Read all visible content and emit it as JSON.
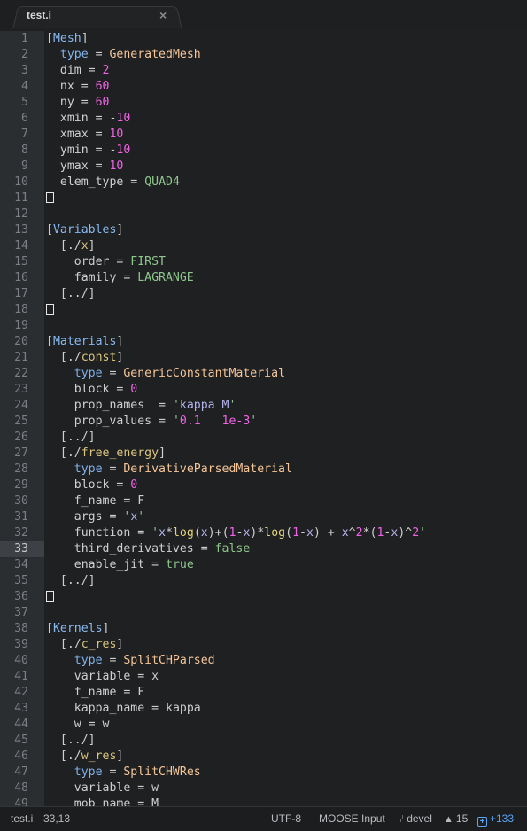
{
  "tab": {
    "title": "test.i",
    "close_symbol": "×"
  },
  "editor": {
    "current_line": 33,
    "lines": [
      [
        [
          "sec",
          "["
        ],
        [
          "secname",
          "Mesh"
        ],
        [
          "sec",
          "]"
        ]
      ],
      [
        [
          "ind",
          "  "
        ],
        [
          "type",
          "type"
        ],
        [
          "op",
          " = "
        ],
        [
          "cls",
          "GeneratedMesh"
        ]
      ],
      [
        [
          "ind",
          "  "
        ],
        [
          "txt",
          "dim"
        ],
        [
          "op",
          " = "
        ],
        [
          "num",
          "2"
        ]
      ],
      [
        [
          "ind",
          "  "
        ],
        [
          "txt",
          "nx"
        ],
        [
          "op",
          " = "
        ],
        [
          "num",
          "60"
        ]
      ],
      [
        [
          "ind",
          "  "
        ],
        [
          "txt",
          "ny"
        ],
        [
          "op",
          " = "
        ],
        [
          "num",
          "60"
        ]
      ],
      [
        [
          "ind",
          "  "
        ],
        [
          "txt",
          "xmin"
        ],
        [
          "op",
          " = -"
        ],
        [
          "num",
          "10"
        ]
      ],
      [
        [
          "ind",
          "  "
        ],
        [
          "txt",
          "xmax"
        ],
        [
          "op",
          " = "
        ],
        [
          "num",
          "10"
        ]
      ],
      [
        [
          "ind",
          "  "
        ],
        [
          "txt",
          "ymin"
        ],
        [
          "op",
          " = -"
        ],
        [
          "num",
          "10"
        ]
      ],
      [
        [
          "ind",
          "  "
        ],
        [
          "txt",
          "ymax"
        ],
        [
          "op",
          " = "
        ],
        [
          "num",
          "10"
        ]
      ],
      [
        [
          "ind",
          "  "
        ],
        [
          "txt",
          "elem_type"
        ],
        [
          "op",
          " = "
        ],
        [
          "const",
          "QUAD4"
        ]
      ],
      [
        [
          "box",
          ""
        ]
      ],
      [],
      [
        [
          "sec",
          "["
        ],
        [
          "secname",
          "Variables"
        ],
        [
          "sec",
          "]"
        ]
      ],
      [
        [
          "ind",
          "  "
        ],
        [
          "sec",
          "[./"
        ],
        [
          "sub",
          "x"
        ],
        [
          "sec",
          "]"
        ]
      ],
      [
        [
          "ind",
          "    "
        ],
        [
          "txt",
          "order"
        ],
        [
          "op",
          " = "
        ],
        [
          "const",
          "FIRST"
        ]
      ],
      [
        [
          "ind",
          "    "
        ],
        [
          "txt",
          "family"
        ],
        [
          "op",
          " = "
        ],
        [
          "const",
          "LAGRANGE"
        ]
      ],
      [
        [
          "ind",
          "  "
        ],
        [
          "sec",
          "[../]"
        ]
      ],
      [
        [
          "box",
          ""
        ]
      ],
      [],
      [
        [
          "sec",
          "["
        ],
        [
          "secname",
          "Materials"
        ],
        [
          "sec",
          "]"
        ]
      ],
      [
        [
          "ind",
          "  "
        ],
        [
          "sec",
          "[./"
        ],
        [
          "sub",
          "const"
        ],
        [
          "sec",
          "]"
        ]
      ],
      [
        [
          "ind",
          "    "
        ],
        [
          "type",
          "type"
        ],
        [
          "op",
          " = "
        ],
        [
          "cls",
          "GenericConstantMaterial"
        ]
      ],
      [
        [
          "ind",
          "    "
        ],
        [
          "txt",
          "block"
        ],
        [
          "op",
          " = "
        ],
        [
          "num",
          "0"
        ]
      ],
      [
        [
          "ind",
          "    "
        ],
        [
          "txt",
          "prop_names"
        ],
        [
          "op",
          "  = "
        ],
        [
          "q",
          "'"
        ],
        [
          "str",
          "kappa M"
        ],
        [
          "q",
          "'"
        ]
      ],
      [
        [
          "ind",
          "    "
        ],
        [
          "txt",
          "prop_values"
        ],
        [
          "op",
          " = "
        ],
        [
          "q",
          "'"
        ],
        [
          "num",
          "0.1   1e-3"
        ],
        [
          "q",
          "'"
        ]
      ],
      [
        [
          "ind",
          "  "
        ],
        [
          "sec",
          "[../]"
        ]
      ],
      [
        [
          "ind",
          "  "
        ],
        [
          "sec",
          "[./"
        ],
        [
          "sub",
          "free_energy"
        ],
        [
          "sec",
          "]"
        ]
      ],
      [
        [
          "ind",
          "    "
        ],
        [
          "type",
          "type"
        ],
        [
          "op",
          " = "
        ],
        [
          "cls",
          "DerivativeParsedMaterial"
        ]
      ],
      [
        [
          "ind",
          "    "
        ],
        [
          "txt",
          "block"
        ],
        [
          "op",
          " = "
        ],
        [
          "num",
          "0"
        ]
      ],
      [
        [
          "ind",
          "    "
        ],
        [
          "txt",
          "f_name"
        ],
        [
          "op",
          " = "
        ],
        [
          "txt",
          "F"
        ]
      ],
      [
        [
          "ind",
          "    "
        ],
        [
          "txt",
          "args"
        ],
        [
          "op",
          " = "
        ],
        [
          "q",
          "'"
        ],
        [
          "str",
          "x"
        ],
        [
          "q",
          "'"
        ]
      ],
      [
        [
          "ind",
          "    "
        ],
        [
          "txt",
          "function"
        ],
        [
          "op",
          " = "
        ],
        [
          "q",
          "'"
        ],
        [
          "str",
          "x"
        ],
        [
          "op",
          "*"
        ],
        [
          "fn",
          "log"
        ],
        [
          "op",
          "("
        ],
        [
          "str",
          "x"
        ],
        [
          "op",
          ")+("
        ],
        [
          "num",
          "1"
        ],
        [
          "op",
          "-"
        ],
        [
          "str",
          "x"
        ],
        [
          "op",
          ")*"
        ],
        [
          "fn",
          "log"
        ],
        [
          "op",
          "("
        ],
        [
          "num",
          "1"
        ],
        [
          "op",
          "-"
        ],
        [
          "str",
          "x"
        ],
        [
          "op",
          ") + "
        ],
        [
          "str",
          "x"
        ],
        [
          "op",
          "^"
        ],
        [
          "num",
          "2"
        ],
        [
          "op",
          "*("
        ],
        [
          "num",
          "1"
        ],
        [
          "op",
          "-"
        ],
        [
          "str",
          "x"
        ],
        [
          "op",
          ")^"
        ],
        [
          "num",
          "2"
        ],
        [
          "q",
          "'"
        ]
      ],
      [
        [
          "ind",
          "    "
        ],
        [
          "txt",
          "third_derivatives"
        ],
        [
          "op",
          " = "
        ],
        [
          "const",
          "false"
        ]
      ],
      [
        [
          "ind",
          "    "
        ],
        [
          "txt",
          "enable_jit"
        ],
        [
          "op",
          " = "
        ],
        [
          "const",
          "true"
        ]
      ],
      [
        [
          "ind",
          "  "
        ],
        [
          "sec",
          "[../]"
        ]
      ],
      [
        [
          "box",
          ""
        ]
      ],
      [],
      [
        [
          "sec",
          "["
        ],
        [
          "secname",
          "Kernels"
        ],
        [
          "sec",
          "]"
        ]
      ],
      [
        [
          "ind",
          "  "
        ],
        [
          "sec",
          "[./"
        ],
        [
          "sub",
          "c_res"
        ],
        [
          "sec",
          "]"
        ]
      ],
      [
        [
          "ind",
          "    "
        ],
        [
          "type",
          "type"
        ],
        [
          "op",
          " = "
        ],
        [
          "cls",
          "SplitCHParsed"
        ]
      ],
      [
        [
          "ind",
          "    "
        ],
        [
          "txt",
          "variable"
        ],
        [
          "op",
          " = "
        ],
        [
          "txt",
          "x"
        ]
      ],
      [
        [
          "ind",
          "    "
        ],
        [
          "txt",
          "f_name"
        ],
        [
          "op",
          " = "
        ],
        [
          "txt",
          "F"
        ]
      ],
      [
        [
          "ind",
          "    "
        ],
        [
          "txt",
          "kappa_name"
        ],
        [
          "op",
          " = "
        ],
        [
          "txt",
          "kappa"
        ]
      ],
      [
        [
          "ind",
          "    "
        ],
        [
          "txt",
          "w"
        ],
        [
          "op",
          " = "
        ],
        [
          "txt",
          "w"
        ]
      ],
      [
        [
          "ind",
          "  "
        ],
        [
          "sec",
          "[../]"
        ]
      ],
      [
        [
          "ind",
          "  "
        ],
        [
          "sec",
          "[./"
        ],
        [
          "sub",
          "w_res"
        ],
        [
          "sec",
          "]"
        ]
      ],
      [
        [
          "ind",
          "    "
        ],
        [
          "type",
          "type"
        ],
        [
          "op",
          " = "
        ],
        [
          "cls",
          "SplitCHWRes"
        ]
      ],
      [
        [
          "ind",
          "    "
        ],
        [
          "txt",
          "variable"
        ],
        [
          "op",
          " = "
        ],
        [
          "txt",
          "w"
        ]
      ],
      [
        [
          "ind",
          "    "
        ],
        [
          "txt",
          "mob_name"
        ],
        [
          "op",
          " = "
        ],
        [
          "txt",
          "M"
        ]
      ]
    ]
  },
  "status_bar": {
    "filename": "test.i",
    "cursor_position": "33,13",
    "encoding": "UTF-8",
    "syntax": "MOOSE Input",
    "branch_icon": "git-branch-icon",
    "branch": "devel",
    "ahead_icon": "arrow-up-icon",
    "ahead_count": "15",
    "diff_icon": "diff-added-icon",
    "diff_count": "+133"
  },
  "colors": {
    "background": "#1f2022",
    "gutter": "#2b2e31",
    "section": "#86b9f0",
    "subsection": "#dac57c",
    "type_key": "#7fb3ec",
    "class_value": "#f5c598",
    "number": "#f262e6",
    "constant": "#8ec58b",
    "string": "#b6b3ef",
    "function": "#e3d27a",
    "diff_accent": "#5ba4f5"
  }
}
